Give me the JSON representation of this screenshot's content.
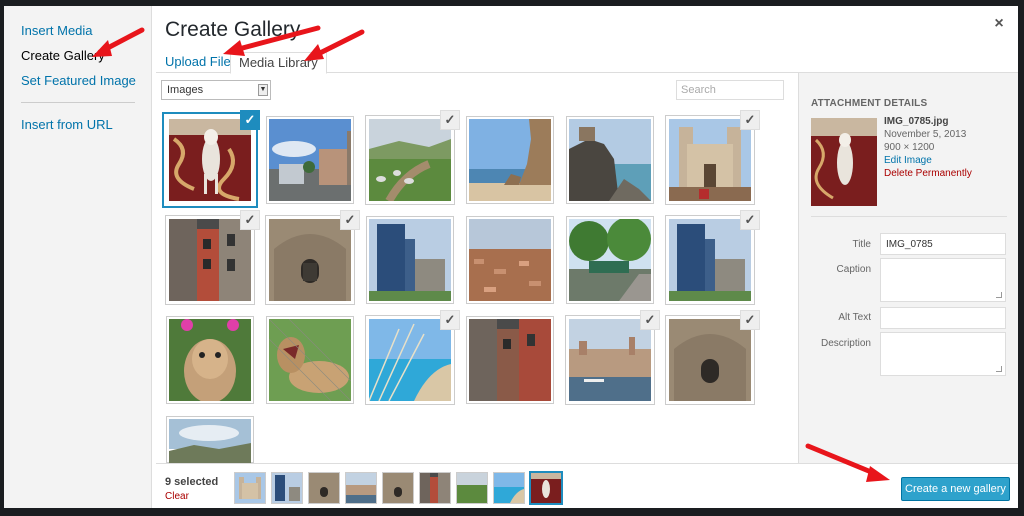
{
  "menu": {
    "items": [
      {
        "label": "Insert Media"
      },
      {
        "label": "Create Gallery"
      },
      {
        "label": "Set Featured Image"
      },
      {
        "label": "Insert from URL"
      }
    ]
  },
  "frame": {
    "title": "Create Gallery",
    "close_icon": "×"
  },
  "router": {
    "tabs": [
      {
        "label": "Upload Files"
      },
      {
        "label": "Media Library"
      }
    ]
  },
  "toolbar": {
    "filter_value": "Images",
    "search_placeholder": "Search"
  },
  "grid": {
    "items": [
      {
        "name": "rug-dog",
        "selected": true
      },
      {
        "name": "street-sky",
        "selected": false
      },
      {
        "name": "sheep-field",
        "selected": true
      },
      {
        "name": "beach-rock",
        "selected": false
      },
      {
        "name": "coast-fort",
        "selected": false
      },
      {
        "name": "church",
        "selected": true
      },
      {
        "name": "alley",
        "selected": true
      },
      {
        "name": "stone-building",
        "selected": true
      },
      {
        "name": "tower",
        "selected": false
      },
      {
        "name": "rooftops",
        "selected": false
      },
      {
        "name": "trees-street",
        "selected": false
      },
      {
        "name": "tower-2",
        "selected": true
      },
      {
        "name": "llama",
        "selected": false
      },
      {
        "name": "lion",
        "selected": false
      },
      {
        "name": "blue-bay",
        "selected": true
      },
      {
        "name": "alley-2",
        "selected": false
      },
      {
        "name": "harbor-town",
        "selected": true
      },
      {
        "name": "stone-building-2",
        "selected": true
      },
      {
        "name": "valley",
        "selected": false
      }
    ]
  },
  "details": {
    "heading": "ATTACHMENT DETAILS",
    "filename": "IMG_0785.jpg",
    "date": "November 5, 2013",
    "dimensions": "900 × 1200",
    "edit_label": "Edit Image",
    "delete_label": "Delete Permanently",
    "fields": {
      "title_label": "Title",
      "title_value": "IMG_0785",
      "caption_label": "Caption",
      "alt_label": "Alt Text",
      "description_label": "Description"
    }
  },
  "selection": {
    "count_text": "9 selected",
    "clear_label": "Clear"
  },
  "primary_button": "Create a new gallery",
  "colors": {
    "accent": "#1e8cbe",
    "button": "#2ea2cc",
    "link": "#0073aa",
    "danger": "#a00000",
    "annotation_arrow": "#e8151b"
  }
}
